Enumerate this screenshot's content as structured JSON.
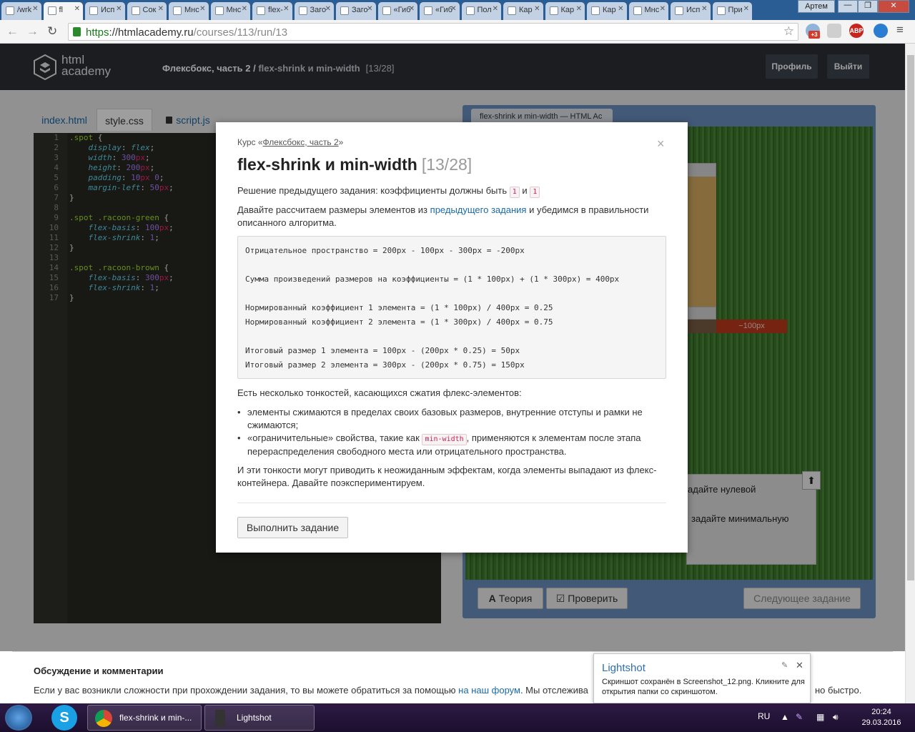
{
  "browser": {
    "tabs": [
      "/wrk",
      "fl",
      "Исп",
      "Сок",
      "Мнс",
      "Мнс",
      "flex-",
      "Заго",
      "Заго",
      "«Гиб",
      "«Гиб",
      "Пол",
      "Кар",
      "Кар",
      "Кар",
      "Мнс",
      "Исп",
      "При"
    ],
    "window_user": "Артем",
    "address": {
      "protocol": "https",
      "host": "://htmlacademy.ru",
      "path": "/courses/113/run/13"
    },
    "ext_badge": "+3",
    "adblock": "ABP"
  },
  "site": {
    "logo_line1": "html",
    "logo_line2": "academy",
    "course": "Флексбокс, часть 2",
    "separator": "/",
    "lesson": "flex-shrink и min-width",
    "progress": "[13/28]",
    "profile_button": "Профиль",
    "logout_button": "Выйти"
  },
  "editor": {
    "tabs": [
      "index.html",
      "style.css",
      "script.js"
    ],
    "active_tab": "style.css",
    "line_numbers": [
      "1",
      "2",
      "3",
      "4",
      "5",
      "6",
      "7",
      "8",
      "9",
      "10",
      "11",
      "12",
      "13",
      "14",
      "15",
      "16",
      "17"
    ],
    "lines": [
      [
        [
          "sel",
          ".spot"
        ],
        [
          "",
          " {"
        ]
      ],
      [
        [
          "",
          "    "
        ],
        [
          "prop",
          "display"
        ],
        [
          "",
          ": "
        ],
        [
          "prop",
          "flex"
        ],
        [
          "",
          ";"
        ]
      ],
      [
        [
          "",
          "    "
        ],
        [
          "prop",
          "width"
        ],
        [
          "",
          ": "
        ],
        [
          "val",
          "300"
        ],
        [
          "unit",
          "px"
        ],
        [
          "",
          ";"
        ]
      ],
      [
        [
          "",
          "    "
        ],
        [
          "prop",
          "height"
        ],
        [
          "",
          ": "
        ],
        [
          "val",
          "200"
        ],
        [
          "unit",
          "px"
        ],
        [
          "",
          ";"
        ]
      ],
      [
        [
          "",
          "    "
        ],
        [
          "prop",
          "padding"
        ],
        [
          "",
          ": "
        ],
        [
          "val",
          "10"
        ],
        [
          "unit",
          "px"
        ],
        [
          "val",
          " 0"
        ],
        [
          "",
          ";"
        ]
      ],
      [
        [
          "",
          "    "
        ],
        [
          "prop",
          "margin-left"
        ],
        [
          "",
          ": "
        ],
        [
          "val",
          "50"
        ],
        [
          "unit",
          "px"
        ],
        [
          "",
          ";"
        ]
      ],
      [
        [
          "",
          "}"
        ]
      ],
      [
        [
          "",
          ""
        ]
      ],
      [
        [
          "sel",
          ".spot .racoon-green"
        ],
        [
          "",
          " {"
        ]
      ],
      [
        [
          "",
          "    "
        ],
        [
          "prop",
          "flex-basis"
        ],
        [
          "",
          ": "
        ],
        [
          "val",
          "100"
        ],
        [
          "unit",
          "px"
        ],
        [
          "",
          ";"
        ]
      ],
      [
        [
          "",
          "    "
        ],
        [
          "prop",
          "flex-shrink"
        ],
        [
          "",
          ": "
        ],
        [
          "val",
          "1"
        ],
        [
          "",
          ";"
        ]
      ],
      [
        [
          "",
          "}"
        ]
      ],
      [
        [
          "",
          ""
        ]
      ],
      [
        [
          "sel",
          ".spot .racoon-brown"
        ],
        [
          "",
          " {"
        ]
      ],
      [
        [
          "",
          "    "
        ],
        [
          "prop",
          "flex-basis"
        ],
        [
          "",
          ": "
        ],
        [
          "val",
          "300"
        ],
        [
          "unit",
          "px"
        ],
        [
          "",
          ";"
        ]
      ],
      [
        [
          "",
          "    "
        ],
        [
          "prop",
          "flex-shrink"
        ],
        [
          "",
          ": "
        ],
        [
          "val",
          "1"
        ],
        [
          "",
          ";"
        ]
      ],
      [
        [
          "",
          "}"
        ]
      ]
    ]
  },
  "preview": {
    "tab_title": "flex-shrink и min-width — HTML Ac",
    "neg_label": "−100px",
    "task_fragment_1": "адайте нулевой",
    "task_fragment_2": "задайте минимальную",
    "theory_button": "Теория",
    "check_button": "Проверить",
    "next_button": "Следующее задание"
  },
  "modal": {
    "course_prefix": "Курс «",
    "course_link": "Флексбокс, часть 2",
    "course_suffix": "»",
    "title": "flex-shrink и min-width",
    "title_count": "[13/28]",
    "p1_text": "Решение предыдущего задания: коэффициенты должны быть",
    "p1_val1": "1",
    "p1_and": "и",
    "p1_val2": "1",
    "p2_before": "Давайте рассчитаем размеры элементов из",
    "p2_link": "предыдущего задания",
    "p2_after": "и убедимся в правильности описанного алгоритма.",
    "code_lines": [
      "Отрицательное пространство = 200px - 100px - 300px = -200px",
      "Сумма произведений размеров на коэффициенты = (1 * 100px) + (1 * 300px) = 400px",
      "Нормированный коэффициент 1 элемента = (1 * 100px) / 400px = 0.25",
      "Нормированный коэффициент 2 элемента = (1 * 300px) / 400px = 0.75",
      "Итоговый размер 1 элемента = 100px - (200px * 0.25) = 50px",
      "Итоговый размер 2 элемента = 300px - (200px * 0.75) = 150px"
    ],
    "p3": "Есть несколько тонкостей, касающихся сжатия флекс-элементов:",
    "bullet1": "элементы сжимаются в пределах своих базовых размеров, внутренние отступы и рамки не сжимаются;",
    "bullet2_before": "«ограничительные» свойства, такие как",
    "bullet2_code": "min-width",
    "bullet2_after": ", применяются к элементам после этапа перераспределения свободного места или отрицательного пространства.",
    "p4": "И эти тонкости могут приводить к неожиданным эффектам, когда элементы выпадают из флекс-контейнера. Давайте поэкспериментируем.",
    "run_button": "Выполнить задание",
    "close": "×"
  },
  "footer": {
    "heading": "Обсуждение и комментарии",
    "text_before": "Если у вас возникли сложности при прохождении задания, то вы можете обратиться за помощью",
    "link": "на наш форум",
    "text_after": ". Мы отслежива",
    "text_tail": "но быстро."
  },
  "toast": {
    "title": "Lightshot",
    "message": "Скриншот сохранён в Screenshot_12.png. Кликните для открытия папки со скриншотом."
  },
  "taskbar": {
    "chrome_label": "flex-shrink и min-...",
    "lightshot_label": "Lightshot",
    "lang": "RU",
    "time": "20:24",
    "date": "29.03.2016"
  }
}
